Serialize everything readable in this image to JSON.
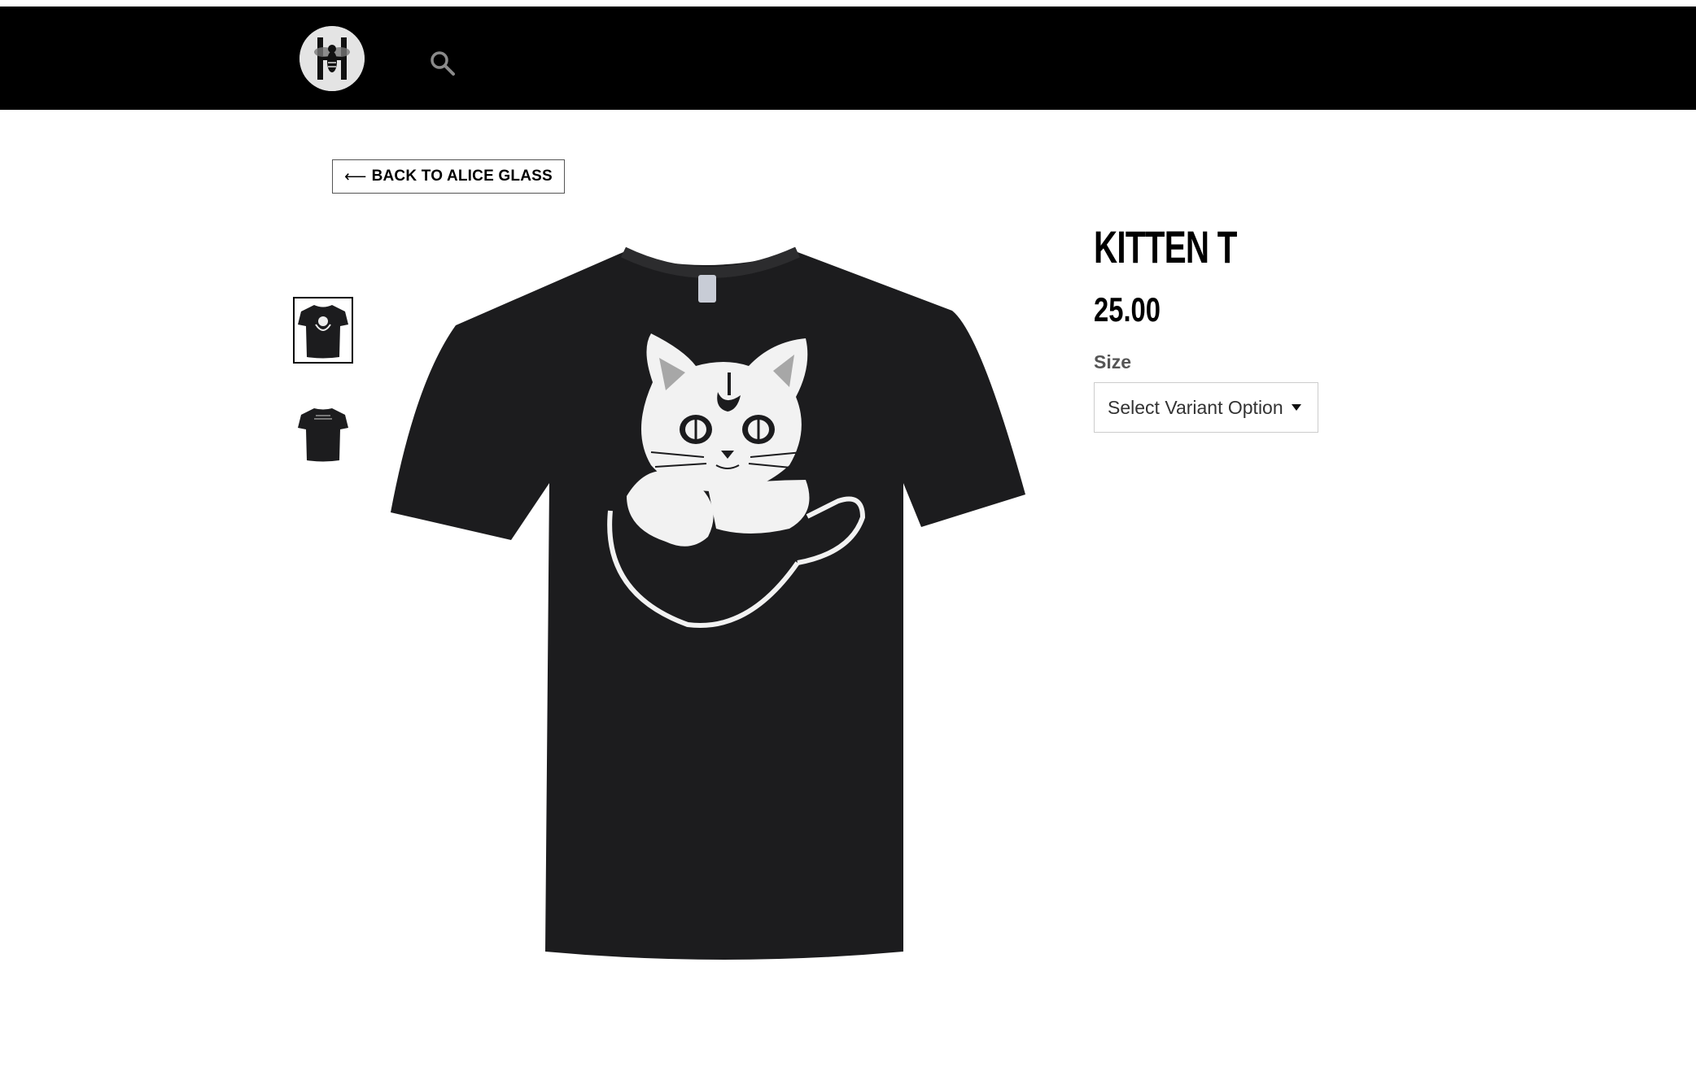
{
  "header": {
    "logo_alt": "H bee logo",
    "search_icon": "search-icon"
  },
  "nav": {
    "back_label": "BACK TO ALICE GLASS",
    "back_arrow": "⟵"
  },
  "product": {
    "title": "KITTEN T",
    "price": "25.00",
    "size_label": "Size",
    "size_select_value": "Select Variant Option",
    "thumbnails": [
      {
        "name": "front",
        "active": true
      },
      {
        "name": "back",
        "active": false
      }
    ]
  },
  "colors": {
    "header_bg": "#000000",
    "shirt": "#1c1c1e",
    "print": "#f2f2f2"
  }
}
